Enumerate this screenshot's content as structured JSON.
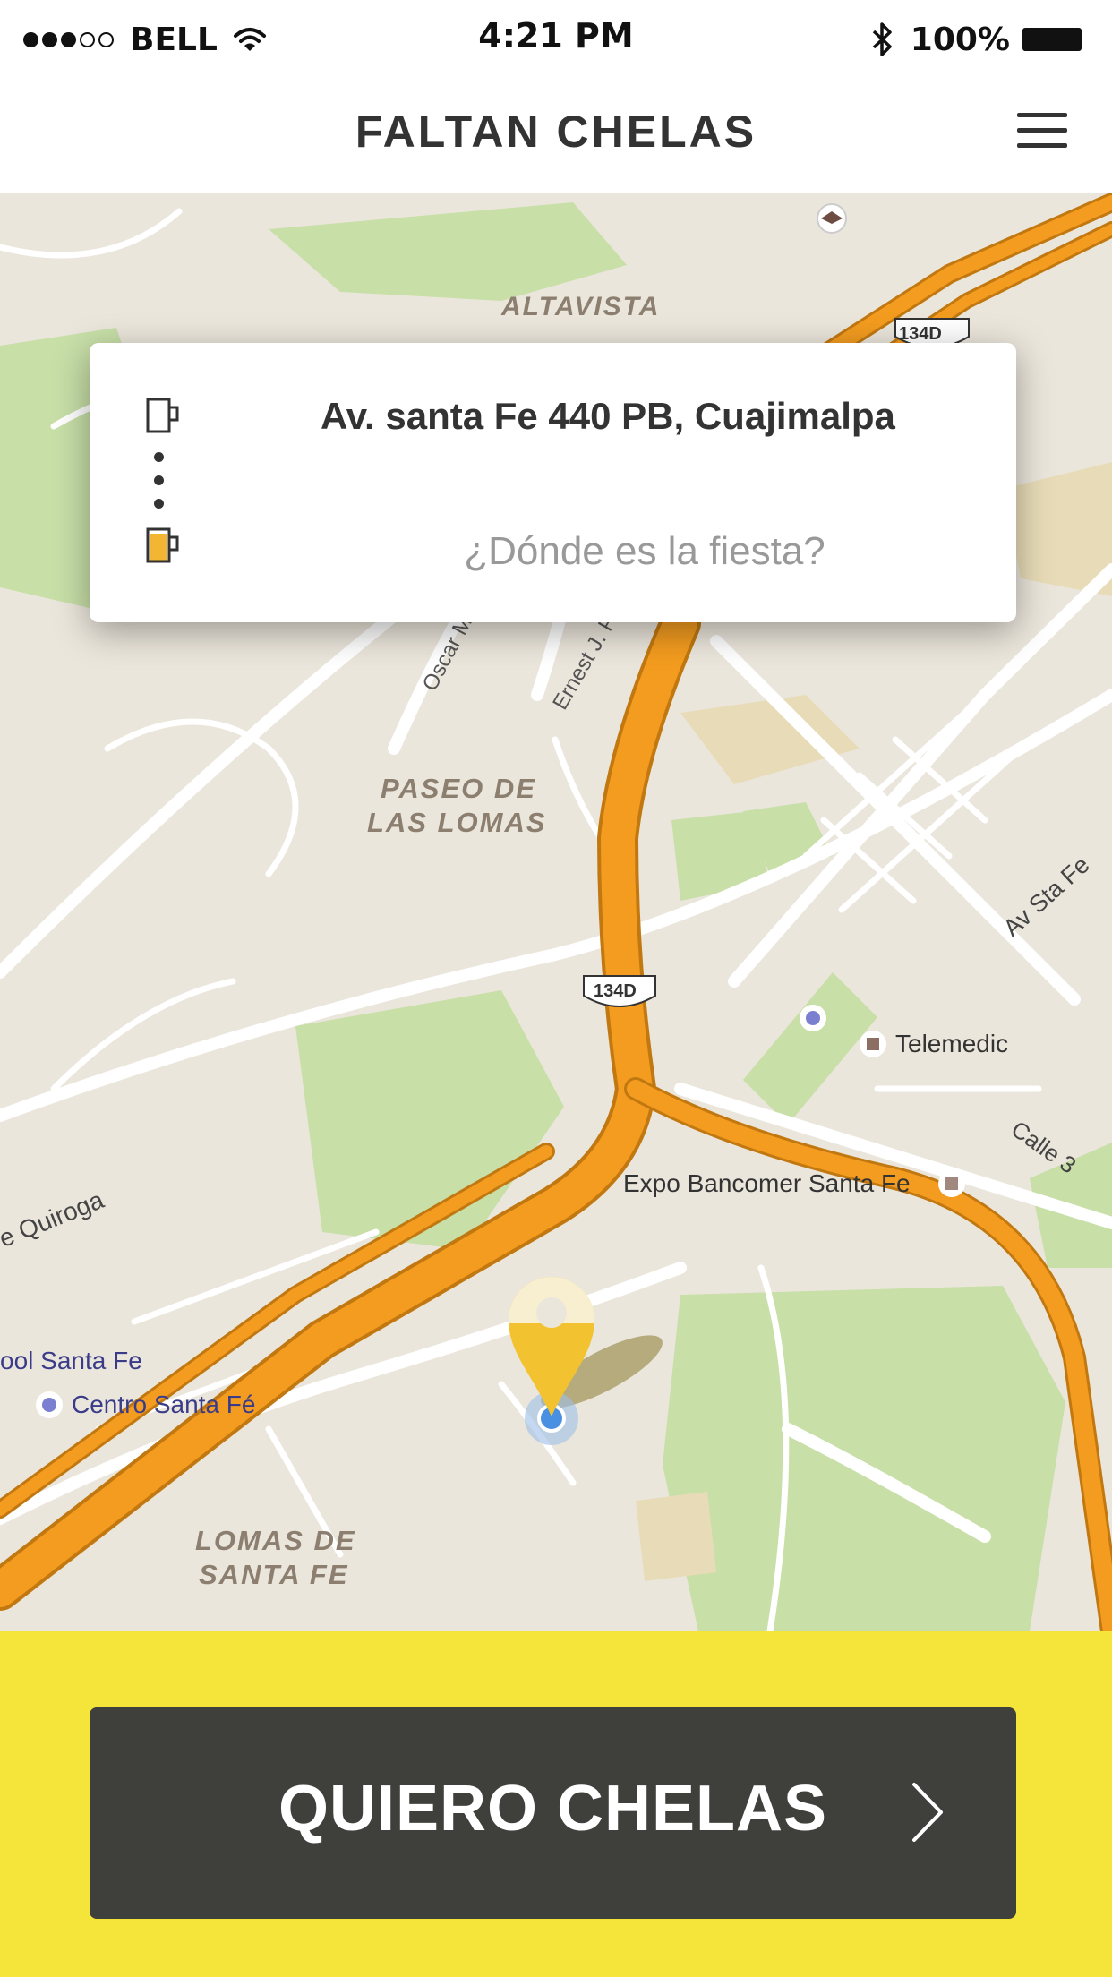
{
  "status_bar": {
    "carrier": "BELL",
    "time": "4:21 PM",
    "battery": "100%",
    "icons": [
      "signal-icon",
      "wifi-icon",
      "bluetooth-icon",
      "battery-icon"
    ]
  },
  "nav": {
    "title": "FALTAN CHELAS",
    "menu_icon": "hamburger-menu-icon"
  },
  "trip_card": {
    "origin_icon": "empty-mug-icon",
    "origin_address": "Av. santa Fe 440 PB, Cuajimalpa",
    "destination_icon": "full-beer-mug-icon",
    "destination_placeholder": "¿Dónde es la fiesta?"
  },
  "map": {
    "labels": {
      "altavista": "ALTAVISTA",
      "paseo_1": "PASEO DE",
      "paseo_2": "LAS LOMAS",
      "lomas_1": "LOMAS DE",
      "lomas_2": "SANTA FE",
      "oscar": "Oscar M",
      "ernest": "Ernest J. P",
      "av_sta_fe": "Av Sta Fe",
      "calle3": "Calle 3",
      "quiroga": "e Quiroga",
      "telemedic": "Telemedic",
      "expo": "Expo Bancomer Santa Fe",
      "school": "ool Santa Fe",
      "centro": "Centro Santa Fé",
      "route_top": "134D",
      "route_mid": "134D"
    },
    "pin_icon": "beer-location-pin-icon"
  },
  "cta": {
    "label": "QUIERO CHELAS",
    "icon": "chevron-right-icon"
  },
  "colors": {
    "footer_bg": "#f5e43a",
    "cta_bg": "#3f3f3c",
    "highway": "#f39c1f",
    "park": "#c8dfa8",
    "map_bg": "#ebe6dc"
  }
}
